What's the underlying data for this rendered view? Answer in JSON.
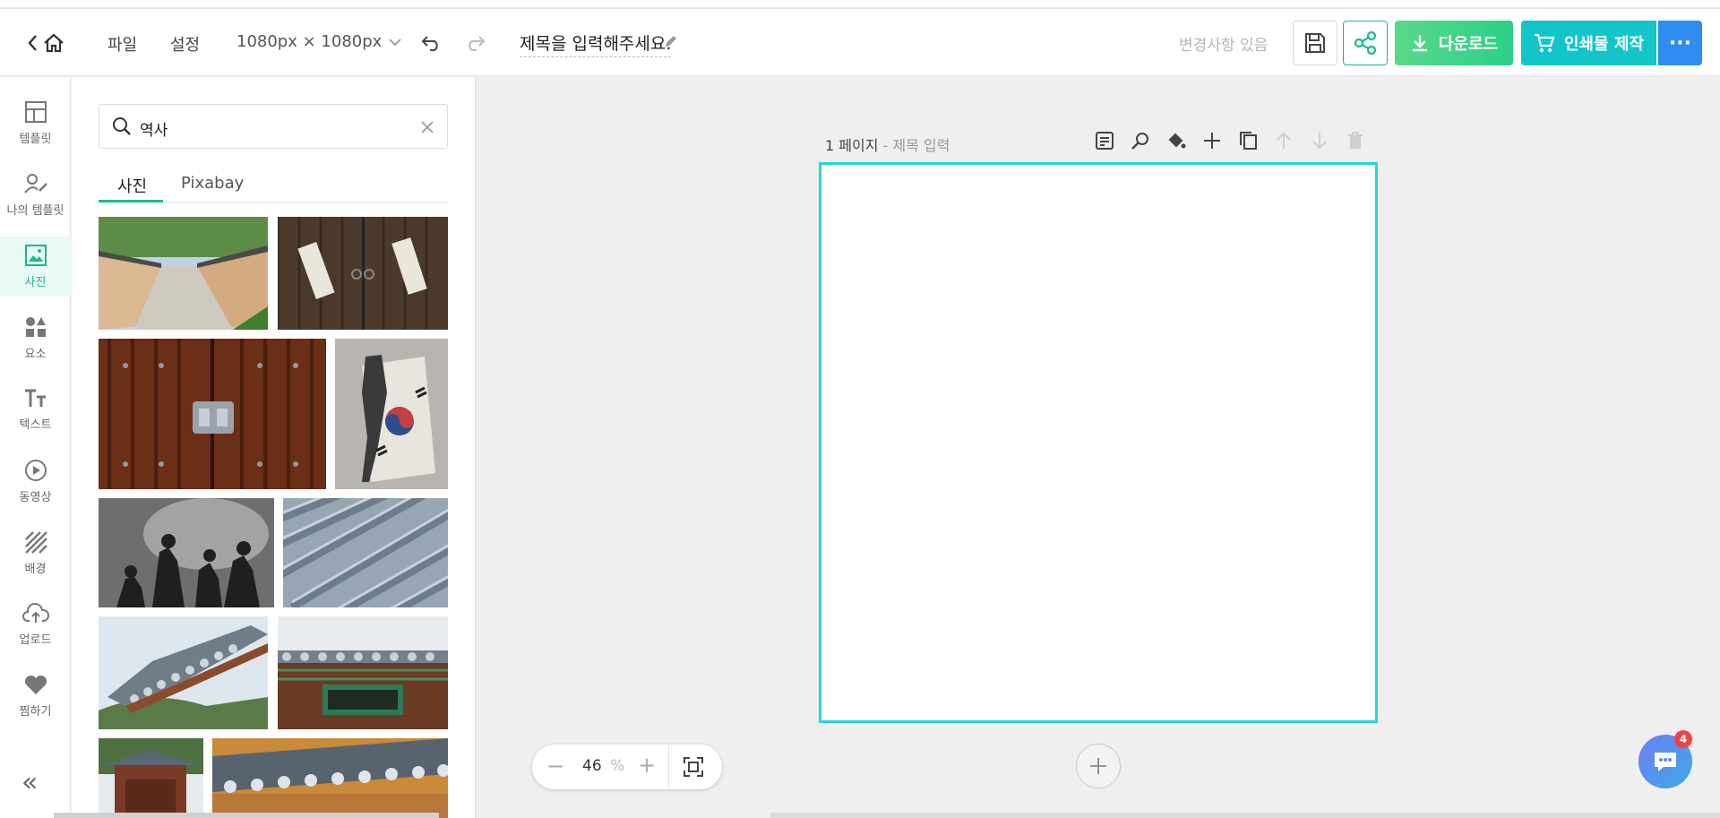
{
  "header": {
    "file_label": "파일",
    "settings_label": "설정",
    "canvas_size": "1080px × 1080px",
    "title_placeholder": "제목을 입력해주세요.",
    "status": "변경사항 있음",
    "download_label": "다운로드",
    "print_label": "인쇄물 제작",
    "more_label": "···"
  },
  "rail": {
    "items": [
      {
        "label": "템플릿",
        "icon": "layout-icon"
      },
      {
        "label": "나의 템플릿",
        "icon": "user-edit-icon"
      },
      {
        "label": "사진",
        "icon": "image-icon"
      },
      {
        "label": "요소",
        "icon": "shapes-icon"
      },
      {
        "label": "텍스트",
        "icon": "text-icon"
      },
      {
        "label": "동영상",
        "icon": "play-icon"
      },
      {
        "label": "배경",
        "icon": "pattern-icon"
      },
      {
        "label": "업로드",
        "icon": "upload-cloud-icon"
      },
      {
        "label": "찜하기",
        "icon": "heart-icon"
      }
    ],
    "collapse_label": "«"
  },
  "panel": {
    "search_value": "역사",
    "tabs": [
      {
        "label": "사진"
      },
      {
        "label": "Pixabay"
      }
    ]
  },
  "canvas": {
    "page_number": "1 페이지",
    "page_title": "- 제목 입력",
    "zoom_value": "46",
    "zoom_unit": "%"
  },
  "chat": {
    "badge": "4"
  },
  "colors": {
    "accent_green": "#1cb98a",
    "artboard_border": "#26d4e0",
    "print_button": "#13c4c9",
    "more_button": "#2f8cf0"
  }
}
